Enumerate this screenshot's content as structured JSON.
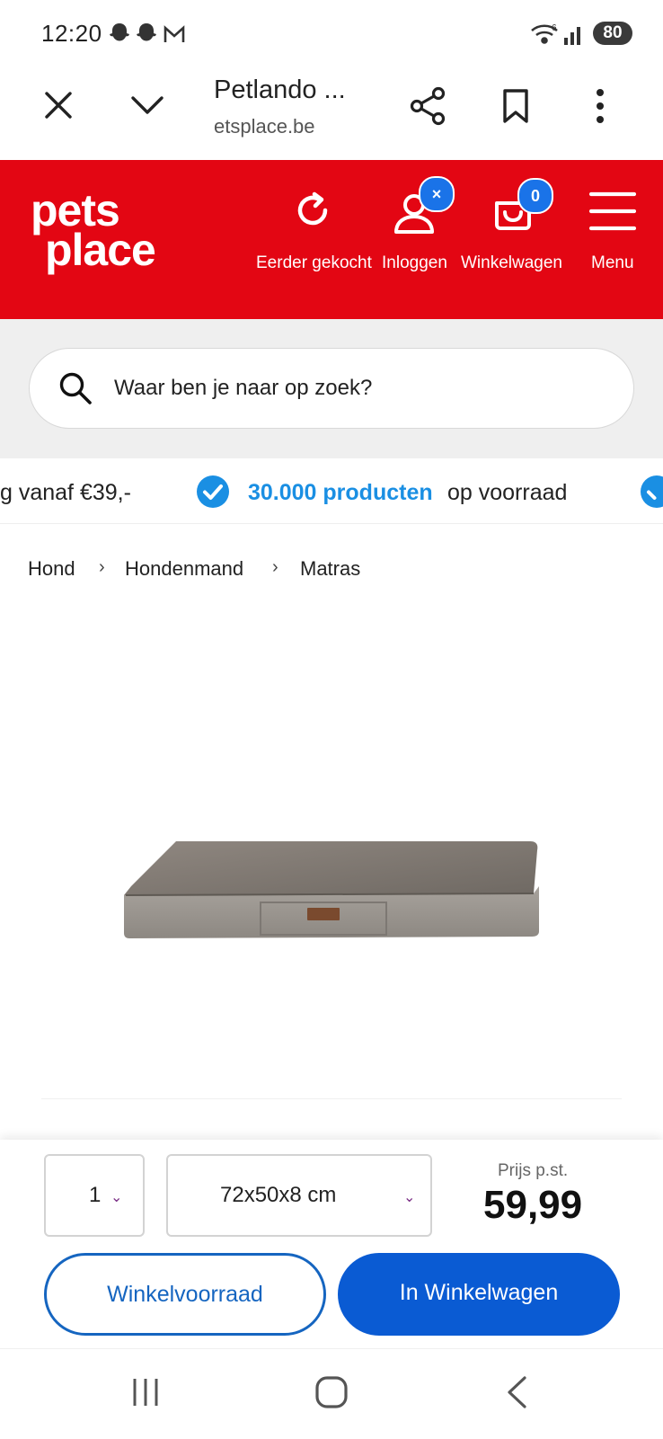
{
  "status_bar": {
    "time": "12:20",
    "battery": "80",
    "icons": [
      "snapchat-ghost-icon",
      "snapchat-ghost-icon",
      "gmail-icon",
      "wifi-icon",
      "signal-icon"
    ]
  },
  "browser": {
    "title": "Petlando ...",
    "url": "etsplace.be",
    "icons": [
      "close-icon",
      "chevron-down-icon",
      "share-icon",
      "bookmark-icon",
      "more-vert-icon"
    ]
  },
  "header": {
    "logo_line1": "pets",
    "logo_line2": "place",
    "items": [
      {
        "label": "Eerder gekocht",
        "icon": "reload-icon"
      },
      {
        "label": "Inloggen",
        "icon": "user-icon",
        "badge": "×"
      },
      {
        "label": "Winkelwagen",
        "icon": "basket-icon",
        "badge": "0"
      },
      {
        "label": "Menu",
        "icon": "hamburger-icon"
      }
    ],
    "colors": {
      "brand": "#e30613",
      "badge": "#1a73e8"
    }
  },
  "search": {
    "placeholder": "Waar ben je naar op zoek?"
  },
  "usp": {
    "left_text": "g vanaf €39,-",
    "highlight": "30.000 producten",
    "rest": "op voorraad"
  },
  "breadcrumb": [
    "Hond",
    "Hondenmand",
    "Matras"
  ],
  "purchase": {
    "quantity": "1",
    "size": "72x50x8 cm",
    "price_label": "Prijs p.st.",
    "price": "59,99",
    "stock_button": "Winkelvoorraad",
    "cart_button": "In Winkelwagen"
  },
  "navbar": {
    "icons": [
      "recent-apps-icon",
      "home-icon",
      "back-icon"
    ]
  }
}
